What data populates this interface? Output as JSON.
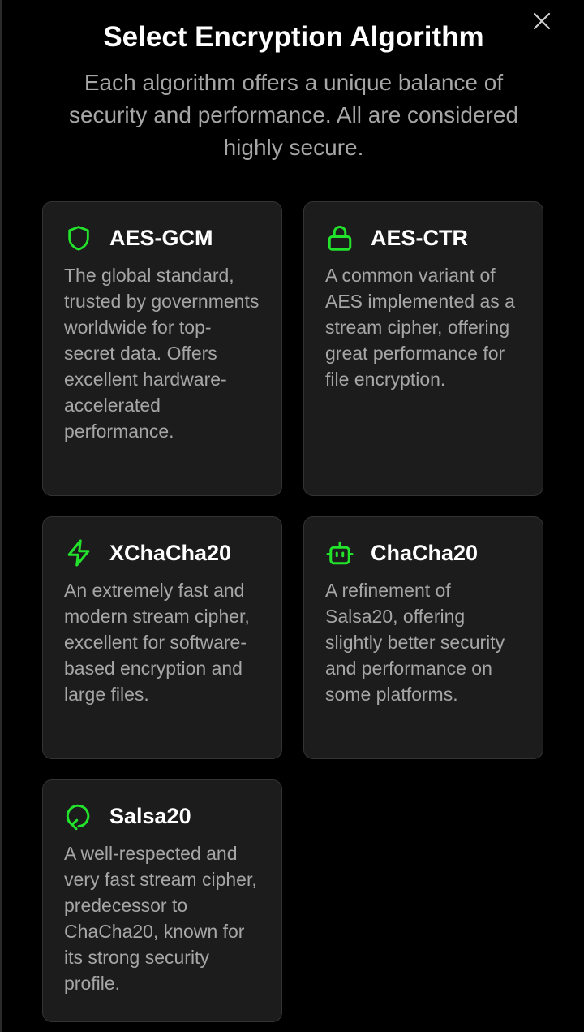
{
  "dialog": {
    "title": "Select Encryption Algorithm",
    "subtitle": "Each algorithm offers a unique balance of security and performance. All are considered highly secure.",
    "close_icon": "close-icon"
  },
  "theme": {
    "accent": "#22e22b",
    "background": "#000000",
    "card_background": "#1c1c1c",
    "title_color": "#ffffff",
    "text_color": "#a6a6a6"
  },
  "algorithms": [
    {
      "name": "AES-GCM",
      "icon": "shield-icon",
      "description": "The global standard, trusted by governments worldwide for top-secret data. Offers excellent hardware-accelerated performance."
    },
    {
      "name": "AES-CTR",
      "icon": "lock-icon",
      "description": "A common variant of AES implemented as a stream cipher, offering great performance for file encryption."
    },
    {
      "name": "XChaCha20",
      "icon": "lightning-bolt-icon",
      "description": "An extremely fast and modern stream cipher, excellent for software-based encryption and large files."
    },
    {
      "name": "ChaCha20",
      "icon": "robot-icon",
      "description": "A refinement of Salsa20, offering slightly better security and performance on some platforms."
    },
    {
      "name": "Salsa20",
      "icon": "refresh-icon",
      "description": "A well-respected and very fast stream cipher, predecessor to ChaCha20, known for its strong security profile."
    }
  ]
}
